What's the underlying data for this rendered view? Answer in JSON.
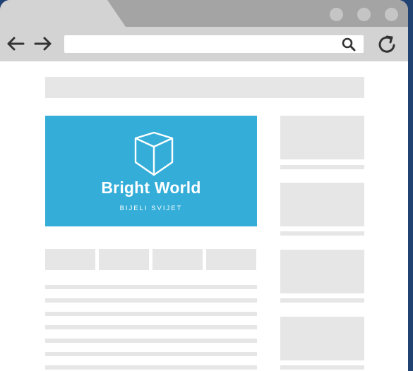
{
  "browser": {
    "tab_label": "",
    "window_controls": [
      "window-dot-icon",
      "window-dot-icon",
      "window-dot-icon"
    ],
    "address_bar": {
      "value": "",
      "placeholder": ""
    },
    "icons": {
      "back": "arrow-left-icon",
      "forward": "arrow-right-icon",
      "search": "search-icon",
      "reload": "reload-icon"
    }
  },
  "page": {
    "hero": {
      "brand_name": "Bright World",
      "tagline": "BIJELI SVIJET",
      "icon": "cube-logo-icon"
    },
    "placeholder_tabs": 4,
    "placeholder_lines": 7,
    "sidebar_cards": 4
  },
  "colors": {
    "background": "#1f4273",
    "titlebar": "#a4a4a4",
    "toolbar": "#d3d3d3",
    "placeholder": "#e6e6e6",
    "accent": "#34aed9",
    "icon": "#333333"
  }
}
